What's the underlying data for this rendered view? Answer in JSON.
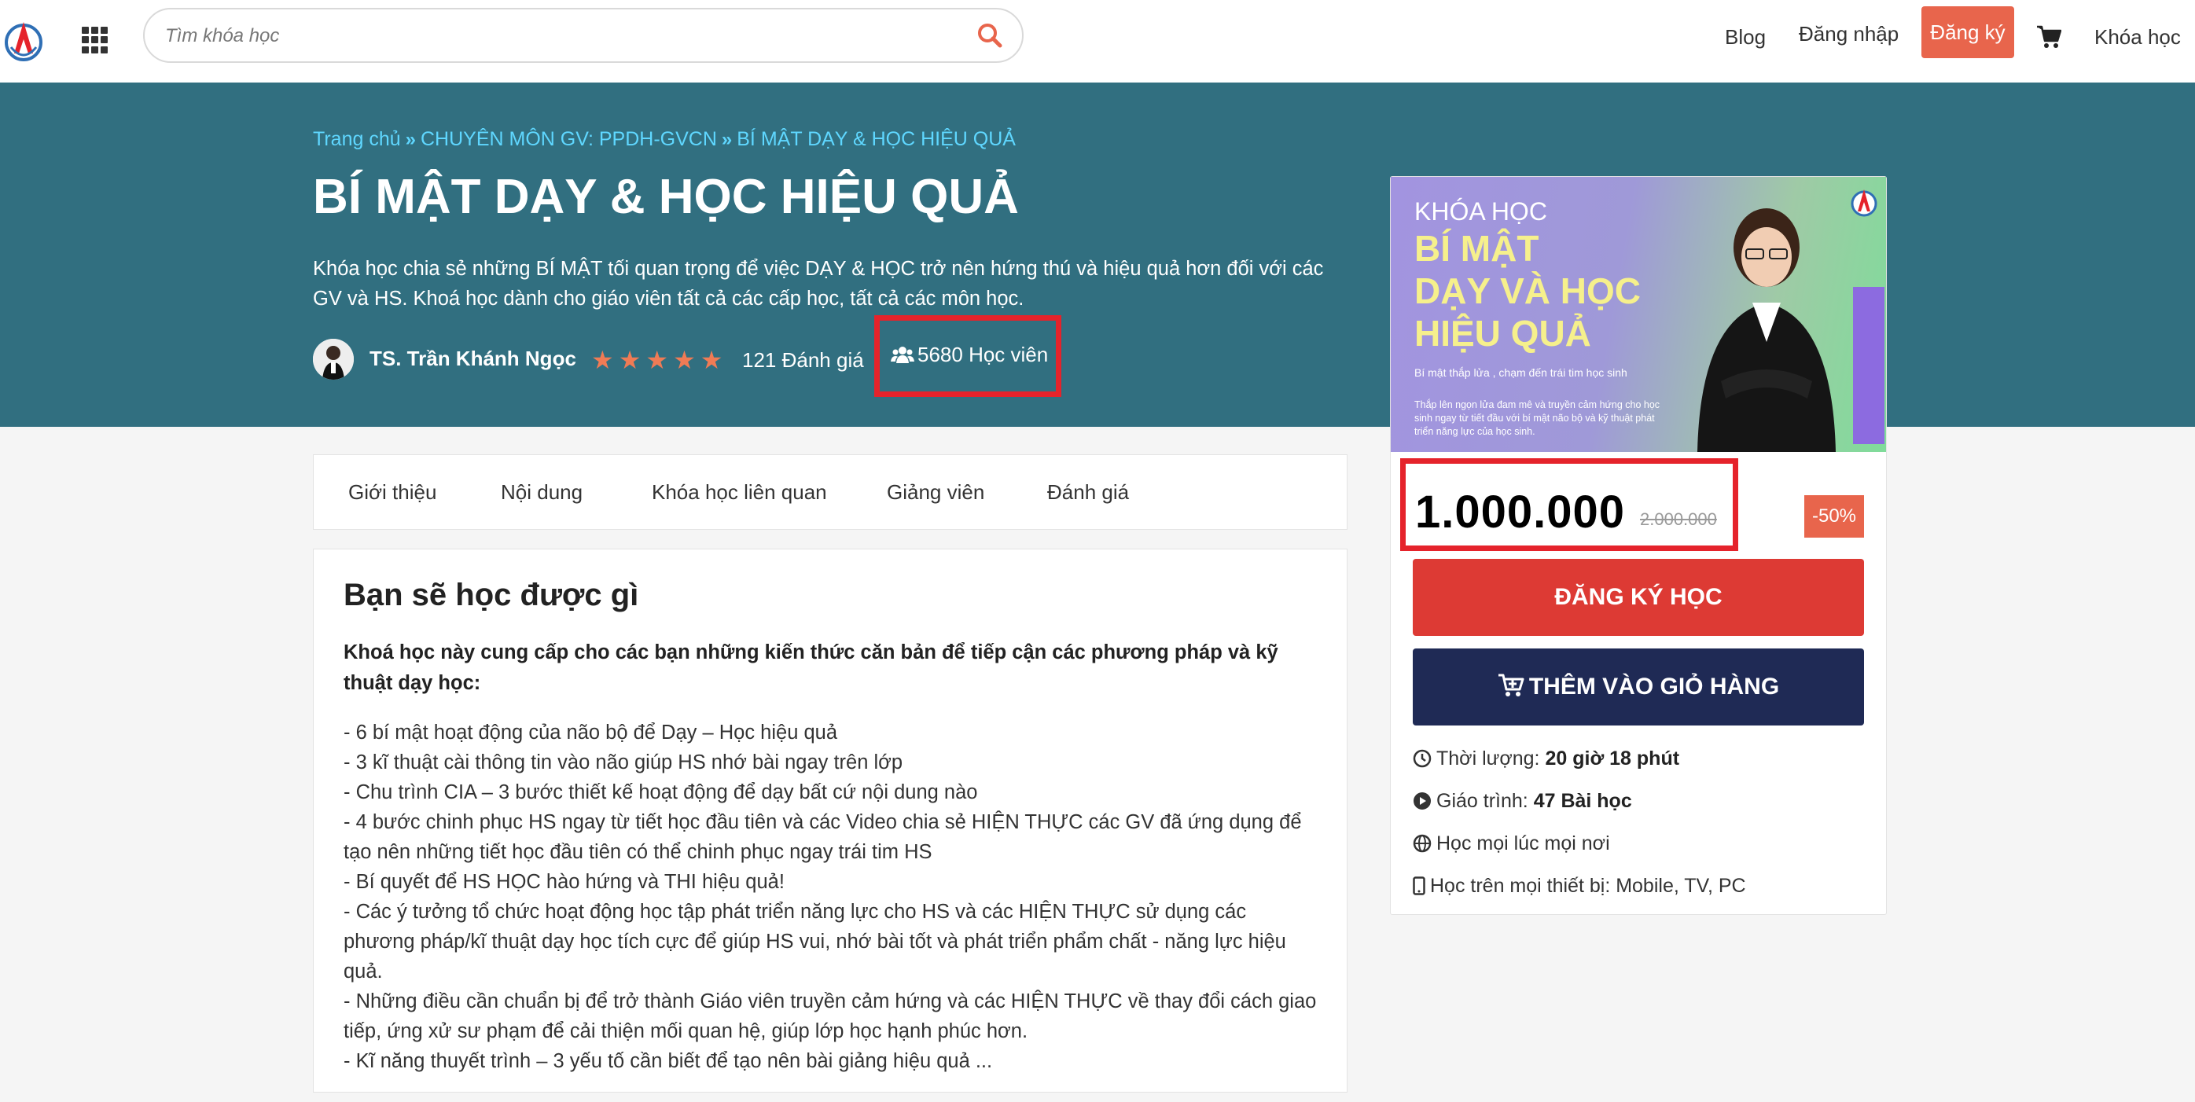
{
  "header": {
    "search_placeholder": "Tìm khóa học",
    "nav": {
      "blog": "Blog",
      "login": "Đăng nhập",
      "signup": "Đăng ký",
      "courses": "Khóa học"
    },
    "accent": "#e8654c"
  },
  "hero": {
    "background": "#316f80",
    "breadcrumb": [
      "Trang chủ",
      "CHUYÊN MÔN GV: PPDH-GVCN",
      "BÍ MẬT DẠY & HỌC HIỆU QUẢ"
    ],
    "title": "BÍ MẬT DẠY & HỌC HIỆU QUẢ",
    "description": "Khóa học chia sẻ những BÍ MẬT tối quan trọng để việc DẠY & HỌC trở nên hứng thú và hiệu quả hơn đối với các GV và HS. Khoá học dành cho giáo viên tất cả các cấp học, tất cả các môn học.",
    "instructor": "TS. Trần Khánh Ngọc",
    "rating_stars": 5,
    "rating_text": "121 Đánh giá",
    "students_text": "5680 Học viên"
  },
  "tabs": [
    "Giới thiệu",
    "Nội dung",
    "Khóa học liên quan",
    "Giảng viên",
    "Đánh giá"
  ],
  "content": {
    "heading": "Bạn sẽ học được gì",
    "intro": "Khoá học này cung cấp cho các bạn những kiến thức căn bản để tiếp cận các phương pháp và kỹ thuật dạy học:",
    "items": [
      "- 6 bí mật hoạt động của não bộ để Dạy – Học hiệu quả",
      "- 3 kĩ thuật cài thông tin vào não giúp HS nhớ bài ngay trên lớp",
      "- Chu trình CIA – 3 bước thiết kế hoạt động để dạy bất cứ nội dung nào",
      "- 4 bước chinh phục HS ngay từ tiết học đầu tiên và các Video chia sẻ HIỆN THỰC các GV đã ứng dụng để tạo nên những tiết học đầu tiên có thể chinh phục ngay trái tim HS",
      "- Bí quyết để HS HỌC hào hứng và THI hiệu quả!",
      "- Các ý tưởng tổ chức hoạt động học tập phát triển năng lực cho HS và các HIỆN THỰC sử dụng các phương pháp/kĩ thuật dạy học tích cực để giúp HS vui, nhớ bài tốt và phát triển phẩm chất - năng lực hiệu quả.",
      "- Những điều cần chuẩn bị để trở thành Giáo viên truyền cảm hứng và các HIỆN THỰC về thay đổi cách giao tiếp, ứng xử sư phạm để cải thiện mối quan hệ, giúp lớp học hạnh phúc hơn.",
      "- Kĩ năng thuyết trình – 3 yếu tố cần biết để tạo nên bài giảng hiệu quả ..."
    ]
  },
  "sidebar": {
    "thumbnail": {
      "label": "KHÓA HỌC",
      "title_lines": [
        "BÍ MẬT",
        "DẠY VÀ HỌC",
        "HIỆU QUẢ"
      ],
      "tagline": "Bí mật thắp lửa , chạm đến trái tim học sinh",
      "subtext": "Thắp lên ngọn lửa đam mê và truyền cảm hứng cho học sinh ngay từ tiết đầu với bí mật não bộ và kỹ thuật phát triển năng lực của học sinh."
    },
    "price": "1.000.000",
    "old_price": "2.000.000",
    "discount": "-50%",
    "enroll_label": "ĐĂNG KÝ HỌC",
    "add_to_cart_label": "THÊM VÀO GIỎ HÀNG",
    "enroll_color": "#dd3a34",
    "cart_color": "#1f2a55",
    "duration_label": "Thời lượng:",
    "duration_value": "20 giờ 18 phút",
    "lessons_label": "Giáo trình:",
    "lessons_value": "47 Bài học",
    "anytime": "Học mọi lúc mọi nơi",
    "devices": "Học trên mọi thiết bị: Mobile, TV, PC"
  }
}
